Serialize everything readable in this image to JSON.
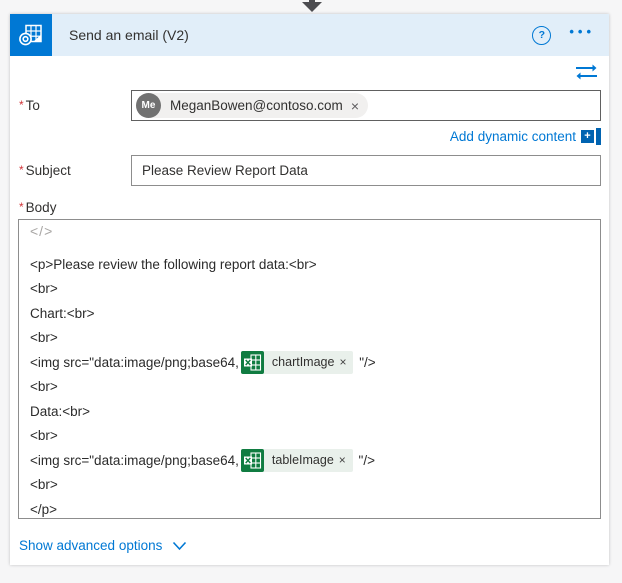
{
  "colors": {
    "accent_blue": "#0078d4",
    "header_bg": "#e1eef9",
    "excel_green": "#107c41",
    "token_bg": "#e9f0eb",
    "required_red": "#d13438"
  },
  "header": {
    "title": "Send an email (V2)",
    "connector_icon": "outlook-icon",
    "help_label": "?",
    "menu_label": "•••"
  },
  "required_marker": "*",
  "fields": {
    "to": {
      "label": "To",
      "chip": {
        "avatar_initials": "Me",
        "email": "MeganBowen@contoso.com",
        "remove_label": "×"
      }
    },
    "add_dynamic_content": {
      "label": "Add dynamic content"
    },
    "subject": {
      "label": "Subject",
      "value": "Please Review Report Data"
    },
    "body": {
      "label": "Body",
      "code_toggle": "</>",
      "lines": [
        {
          "segments": [
            {
              "type": "text",
              "text": "<p>Please review the following report data:<br>"
            }
          ]
        },
        {
          "segments": [
            {
              "type": "text",
              "text": "<br>"
            }
          ]
        },
        {
          "segments": [
            {
              "type": "text",
              "text": "Chart:<br>"
            }
          ]
        },
        {
          "segments": [
            {
              "type": "text",
              "text": "<br>"
            }
          ]
        },
        {
          "segments": [
            {
              "type": "text",
              "text": "<img src=\"data:image/png;base64,"
            },
            {
              "type": "token",
              "label": "chartImage",
              "remove_label": "×"
            },
            {
              "type": "text",
              "text": " \"/>"
            }
          ]
        },
        {
          "segments": [
            {
              "type": "text",
              "text": "<br>"
            }
          ]
        },
        {
          "segments": [
            {
              "type": "text",
              "text": "Data:<br>"
            }
          ]
        },
        {
          "segments": [
            {
              "type": "text",
              "text": "<br>"
            }
          ]
        },
        {
          "segments": [
            {
              "type": "text",
              "text": "<img src=\"data:image/png;base64,"
            },
            {
              "type": "token",
              "label": "tableImage",
              "remove_label": "×"
            },
            {
              "type": "text",
              "text": " \"/>"
            }
          ]
        },
        {
          "segments": [
            {
              "type": "text",
              "text": "<br>"
            }
          ]
        },
        {
          "segments": [
            {
              "type": "text",
              "text": "</p>"
            }
          ]
        }
      ]
    }
  },
  "footer": {
    "show_advanced_label": "Show advanced options"
  }
}
